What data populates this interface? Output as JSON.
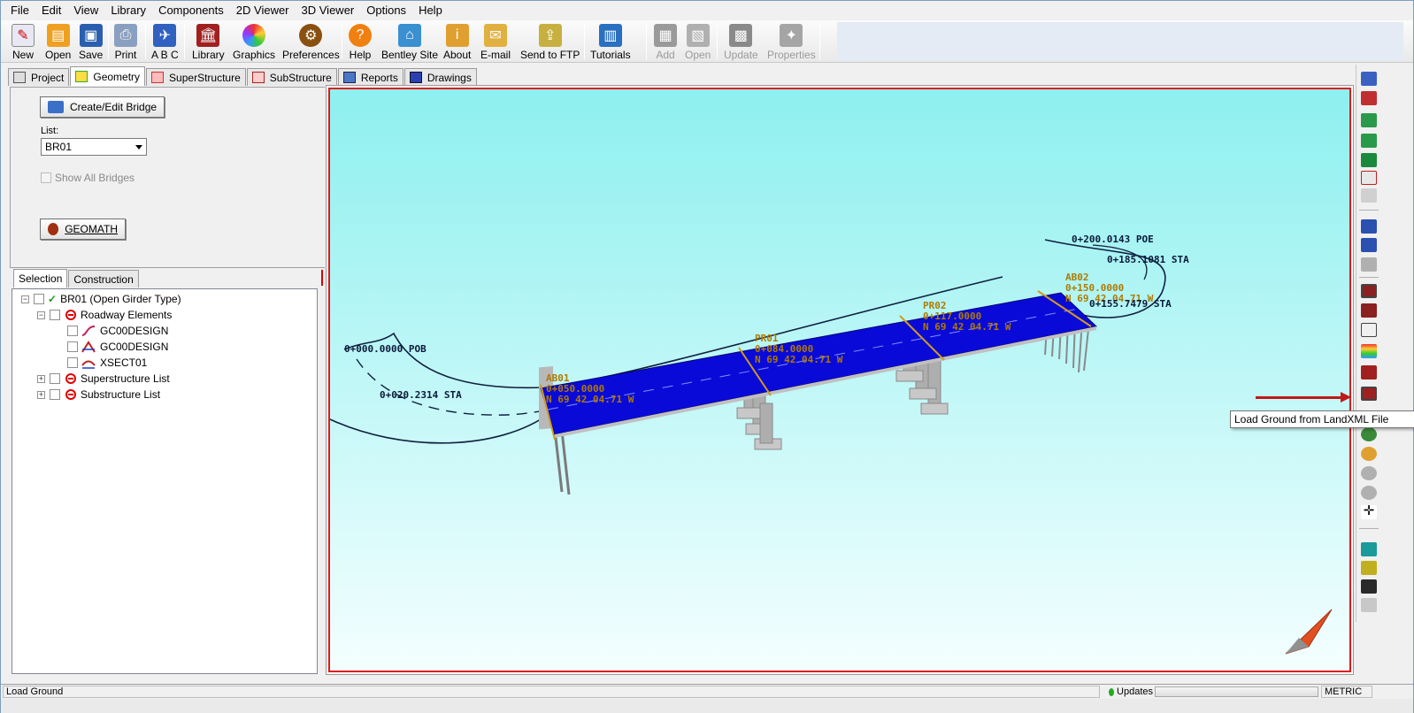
{
  "menu": {
    "items": [
      "File",
      "Edit",
      "View",
      "Library",
      "Components",
      "2D Viewer",
      "3D Viewer",
      "Options",
      "Help"
    ]
  },
  "toolbar": {
    "new": "New",
    "open": "Open",
    "save": "Save",
    "print": "Print",
    "abc": "A B C",
    "library": "Library",
    "graphics": "Graphics",
    "preferences": "Preferences",
    "help": "Help",
    "bentley_site": "Bentley Site",
    "about": "About",
    "email": "E-mail",
    "send_ftp": "Send to FTP",
    "tutorials": "Tutorials",
    "add": "Add",
    "open2": "Open",
    "update": "Update",
    "properties": "Properties"
  },
  "tabs": {
    "project": "Project",
    "geometry": "Geometry",
    "superstructure": "SuperStructure",
    "substructure": "SubStructure",
    "reports": "Reports",
    "drawings": "Drawings",
    "active": "Geometry"
  },
  "left": {
    "create_edit_bridge": "Create/Edit Bridge",
    "list_label": "List:",
    "list_value": "BR01",
    "show_all_bridges": "Show All Bridges",
    "geomath": "GEOMATH"
  },
  "selection_tabs": {
    "selection": "Selection",
    "construction": "Construction"
  },
  "tree": {
    "root": "BR01 (Open Girder Type)",
    "roadway": "Roadway Elements",
    "leaf1": "GC00DESIGN",
    "leaf2": "GC00DESIGN",
    "leaf3": "XSECT01",
    "superstructure": "Superstructure List",
    "substructure": "Substructure List"
  },
  "viewer": {
    "labels": {
      "pob": "0+000.0000 POB",
      "sta20": "0+020.2314 STA",
      "ab01_name": "AB01",
      "ab01_sta": "0+050.0000",
      "ab01_bearing": "N 69 42 04.71 W",
      "pr01_name": "PR01",
      "pr01_sta": "0+084.0000",
      "pr01_bearing": "N 69 42 04.71 W",
      "pr02_name": "PR02",
      "pr02_sta": "0+117.0000",
      "pr02_bearing": "N 69 42 04.71 W",
      "ab02_name": "AB02",
      "ab02_sta": "0+150.0000",
      "ab02_bearing": "N 69 42 04.71 W",
      "poe": "0+200.0143 POE",
      "sta185": "0+185.1081 STA",
      "sta155": "0+155.7479 STA"
    },
    "colors": {
      "deck": "#0a0ad8",
      "sky_top": "#8df0ef",
      "label_dark": "#0a1a3a",
      "label_gold": "#b07a00",
      "frame": "#e01818"
    }
  },
  "tooltip": "Load Ground from LandXML File",
  "status": {
    "left": "Load Ground",
    "updates": "Updates",
    "metric": "METRIC"
  }
}
